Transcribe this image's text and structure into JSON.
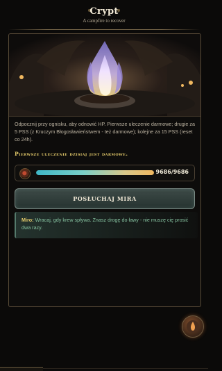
{
  "header": {
    "title": "Crypt",
    "subtitle": "A campfire to recover"
  },
  "scene": {
    "image_alt": "campfire-scene"
  },
  "description": "Odpocznij przy ognisku, aby odnowić HP. Pierwsze uleczenie darmowe; drugie za 5 PSS (z Kruczym Błogosławieństwem - też darmowe); kolejne za 15 PSS (reset co 24h).",
  "free_note": "Pierwsze uleczenie dzisiaj jest darmowe.",
  "hp": {
    "current": 9686,
    "max": 9686,
    "text": "9686/9686",
    "fraction": 1.0
  },
  "listen_button": "POSŁUCHAJ MIRA",
  "miro": {
    "name": "Miro:",
    "quote": "Wracaj, gdy krew spływa. Znasz drogę do ławy - nie muszę cię prosić dwa razy."
  },
  "colors": {
    "accent_gold": "#e2c96a",
    "hp_start": "#3fb8c8",
    "hp_end": "#f0b860",
    "quote_green": "#86c2a0"
  },
  "icons": {
    "hp": "blood-orb-icon",
    "fab": "campfire-portrait-icon"
  }
}
